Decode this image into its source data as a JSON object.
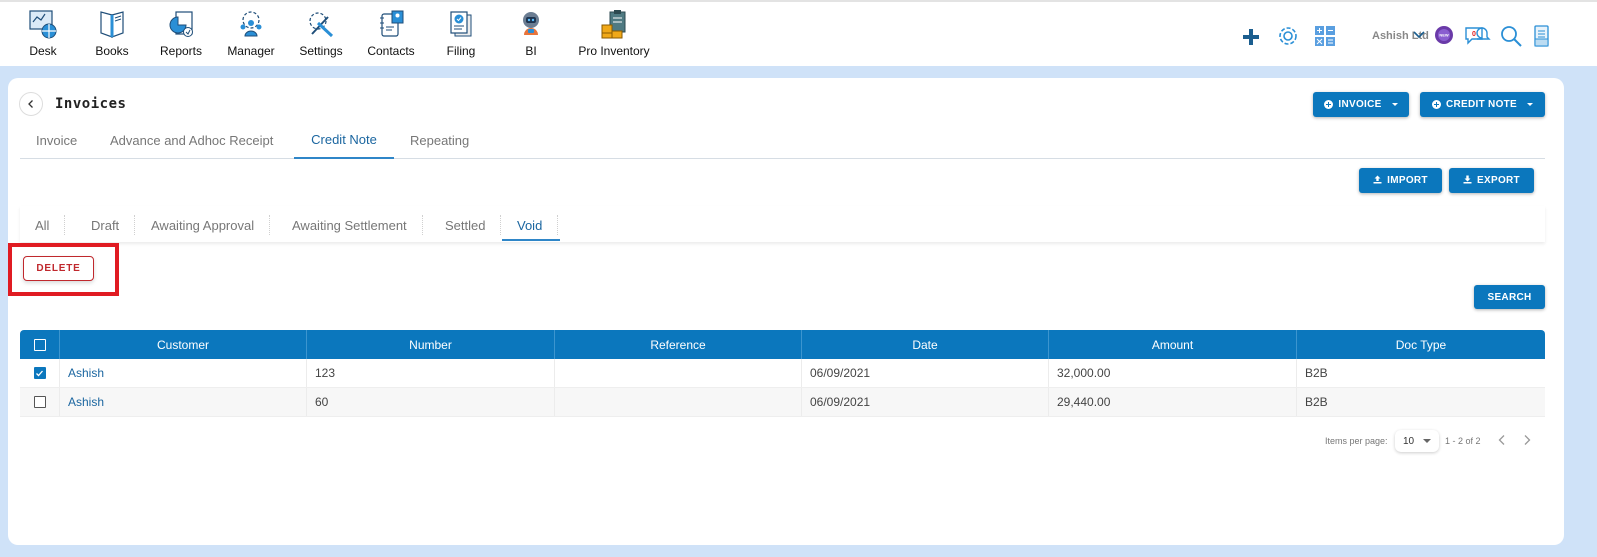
{
  "topnav": {
    "items": [
      {
        "label": "Desk",
        "icon": "desk-icon"
      },
      {
        "label": "Books",
        "icon": "books-icon"
      },
      {
        "label": "Reports",
        "icon": "reports-icon"
      },
      {
        "label": "Manager",
        "icon": "manager-icon"
      },
      {
        "label": "Settings",
        "icon": "settings-tools-icon"
      },
      {
        "label": "Contacts",
        "icon": "contacts-icon"
      },
      {
        "label": "Filing",
        "icon": "filing-icon"
      },
      {
        "label": "BI",
        "icon": "bi-robot-icon"
      },
      {
        "label": "Pro Inventory",
        "icon": "inventory-icon"
      }
    ],
    "company": "Ashish Ltd",
    "notification_count": "0",
    "new_badge": "NEW"
  },
  "page": {
    "title": "Invoices",
    "invoice_button": "INVOICE",
    "credit_note_button": "CREDIT NOTE",
    "import_button": "IMPORT",
    "export_button": "EXPORT",
    "search_button": "SEARCH",
    "delete_button": "DELETE"
  },
  "main_tabs": [
    {
      "label": "Invoice",
      "active": false
    },
    {
      "label": "Advance and Adhoc Receipt",
      "active": false
    },
    {
      "label": "Credit Note",
      "active": true
    },
    {
      "label": "Repeating",
      "active": false
    }
  ],
  "status_tabs": [
    {
      "label": "All",
      "active": false
    },
    {
      "label": "Draft",
      "active": false
    },
    {
      "label": "Awaiting Approval",
      "active": false
    },
    {
      "label": "Awaiting Settlement",
      "active": false
    },
    {
      "label": "Settled",
      "active": false
    },
    {
      "label": "Void",
      "active": true
    }
  ],
  "table": {
    "columns": [
      "Customer",
      "Number",
      "Reference",
      "Date",
      "Amount",
      "Doc Type"
    ],
    "rows": [
      {
        "checked": true,
        "customer": "Ashish",
        "number": "123",
        "reference": "",
        "date": "06/09/2021",
        "amount": "32,000.00",
        "doc_type": "B2B"
      },
      {
        "checked": false,
        "customer": "Ashish",
        "number": "60",
        "reference": "",
        "date": "06/09/2021",
        "amount": "29,440.00",
        "doc_type": "B2B"
      }
    ]
  },
  "pagination": {
    "items_per_page_label": "Items per page:",
    "items_per_page": "10",
    "range": "1 - 2 of 2"
  },
  "colors": {
    "primary": "#0b77bd",
    "danger": "#c0282d",
    "highlight": "#e01b22",
    "background": "#cfe2f8"
  }
}
